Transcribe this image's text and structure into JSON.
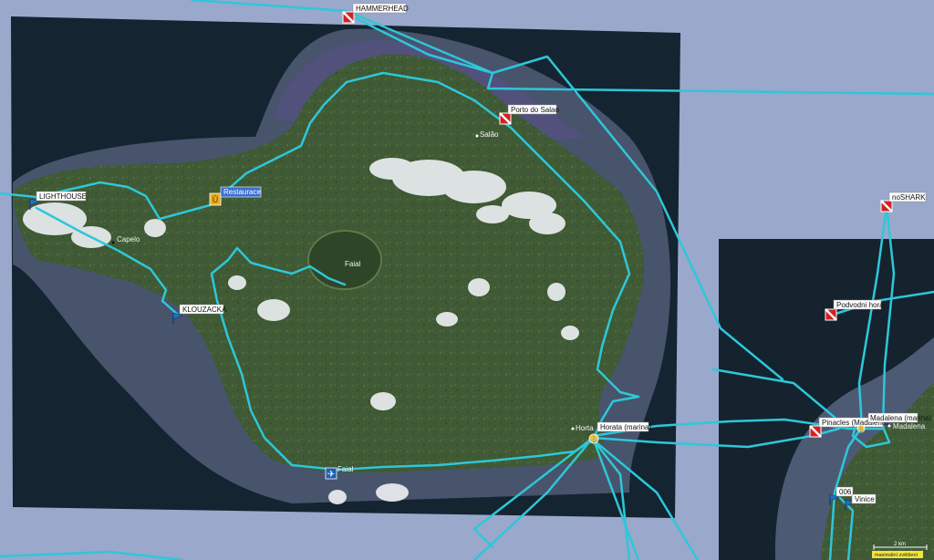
{
  "map": {
    "colors": {
      "background": "#9aa8cc",
      "ocean": "#14232e",
      "shelf": "#4d5a73",
      "land": "#3f5a35",
      "track": "#2ec7d9",
      "dive_site": "#d42020",
      "waypoint_flag": "#1f6fc6"
    },
    "dive_sites": [
      {
        "id": "hammerhead",
        "label": "HAMMERHEAD"
      },
      {
        "id": "porto-do-salao",
        "label": "Porto do Salao"
      },
      {
        "id": "noshark",
        "label": "noSHARK"
      },
      {
        "id": "podvodni-hora",
        "label": "Podvodni hora"
      },
      {
        "id": "pinacles",
        "label": "Pinacles (Madalena)"
      }
    ],
    "waypoints": [
      {
        "id": "lighthouse",
        "label": "LIGHTHOUSE",
        "icon": "flag-icon"
      },
      {
        "id": "klouzacka",
        "label": "KLOUZACKA",
        "icon": "flag-icon"
      },
      {
        "id": "restaurace",
        "label": "Restaurace",
        "icon": "beer-icon",
        "highlighted": true
      },
      {
        "id": "horata-marina",
        "label": "Horata (marina)",
        "icon": "anchor-icon"
      },
      {
        "id": "madalena-marina",
        "label": "Madalena (marina)",
        "icon": "anchor-icon"
      },
      {
        "id": "006",
        "label": "006",
        "icon": "flag-icon"
      },
      {
        "id": "vinice",
        "label": "Vinice",
        "icon": "flag-icon"
      }
    ],
    "place_names": [
      "Salão",
      "Capelo",
      "Faial",
      "Horta",
      "Madalena"
    ],
    "airport_label": "Faial",
    "scale_label": "2 km",
    "zoom_note": "maximální zvětšení"
  }
}
